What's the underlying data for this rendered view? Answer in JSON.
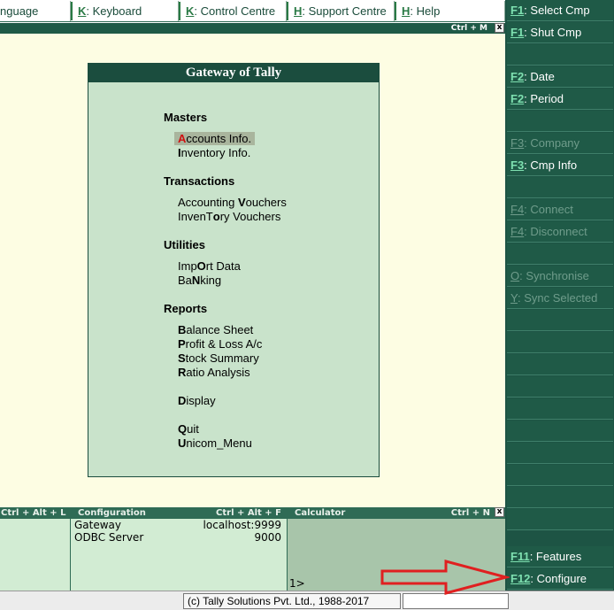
{
  "topbar": {
    "items": [
      {
        "hotkey": "",
        "label": "nguage"
      },
      {
        "hotkey": "K",
        "label": ": Keyboard"
      },
      {
        "hotkey": "K",
        "label": ": Control Centre"
      },
      {
        "hotkey": "H",
        "label": ": Support Centre"
      },
      {
        "hotkey": "H",
        "label": ": Help"
      }
    ]
  },
  "titlestrip": {
    "shortcut": "Ctrl + M",
    "close": "x"
  },
  "gateway": {
    "title": "Gateway of Tally",
    "sections": {
      "masters": "Masters",
      "transactions": "Transactions",
      "utilities": "Utilities",
      "reports": "Reports"
    },
    "items": {
      "accounts_info": {
        "pre": "",
        "hk": "A",
        "post": "ccounts Info."
      },
      "inventory_info": {
        "pre": "",
        "hk": "I",
        "post": "nventory Info."
      },
      "accounting_vouchers": {
        "pre": "Accounting ",
        "hk": "V",
        "post": "ouchers"
      },
      "inventory_vouchers": {
        "pre": "InvenT",
        "hk": "o",
        "post": "ry Vouchers"
      },
      "import_data": {
        "pre": "Imp",
        "hk": "O",
        "post": "rt Data"
      },
      "banking": {
        "pre": "Ba",
        "hk": "N",
        "post": "king"
      },
      "balance_sheet": {
        "pre": "",
        "hk": "B",
        "post": "alance Sheet"
      },
      "profit_loss": {
        "pre": "",
        "hk": "P",
        "post": "rofit & Loss A/c"
      },
      "stock_summary": {
        "pre": "",
        "hk": "S",
        "post": "tock Summary"
      },
      "ratio_analysis": {
        "pre": "",
        "hk": "R",
        "post": "atio Analysis"
      },
      "display": {
        "pre": "",
        "hk": "D",
        "post": "isplay"
      },
      "quit": {
        "pre": "",
        "hk": "Q",
        "post": "uit"
      },
      "unicom_menu": {
        "pre": "",
        "hk": "U",
        "post": "nicom_Menu"
      }
    }
  },
  "bottom": {
    "left_head": "Ctrl + Alt + L",
    "config_head": "Configuration",
    "config_shortcut": "Ctrl + Alt + F",
    "config_rows": [
      {
        "key": "Gateway",
        "value": "localhost:9999"
      },
      {
        "key": "ODBC Server",
        "value": "9000"
      }
    ],
    "calc_head": "Calculator",
    "calc_shortcut": "Ctrl + N",
    "calc_prompt": "1>",
    "close": "x"
  },
  "statusbar": {
    "copyright": "(c) Tally Solutions Pvt. Ltd., 1988-2017"
  },
  "rightbar": {
    "buttons": [
      {
        "key": "F1",
        "label": ": Select Cmp",
        "enabled": true
      },
      {
        "key": "F1",
        "label": ": Shut Cmp",
        "enabled": true
      },
      {
        "key": "F2",
        "label": ": Date",
        "enabled": true
      },
      {
        "key": "F2",
        "label": ": Period",
        "enabled": true
      },
      {
        "key": "F3",
        "label": ": Company",
        "enabled": false
      },
      {
        "key": "F3",
        "label": ": Cmp Info",
        "enabled": true
      },
      {
        "key": "F4",
        "label": ": Connect",
        "enabled": false
      },
      {
        "key": "F4",
        "label": ": Disconnect",
        "enabled": false
      },
      {
        "key": "O",
        "label": ": Synchronise",
        "enabled": false
      },
      {
        "key": "Y",
        "label": ": Sync Selected",
        "enabled": false
      },
      {
        "key": "F11",
        "label": ": Features",
        "enabled": true
      },
      {
        "key": "F12",
        "label": ": Configure",
        "enabled": true
      }
    ]
  },
  "colors": {
    "dark_green": "#1b4d3e",
    "panel_green": "#c9e3cb",
    "cream": "#fdfde3",
    "hotkey_green": "#7ee0b0",
    "selection_red": "#d01010",
    "arrow_red": "#e02020"
  }
}
